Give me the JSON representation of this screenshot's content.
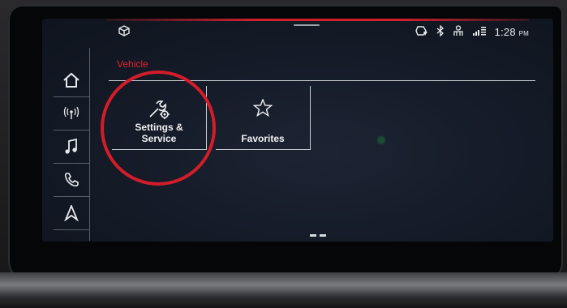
{
  "status_bar": {
    "time": "1:28",
    "ampm": "PM",
    "icons": [
      "car-model-icon",
      "wireless-charging-icon",
      "bluetooth-icon",
      "user-profile-icon",
      "lte-signal-icon"
    ]
  },
  "sidebar": {
    "items": [
      {
        "name": "home",
        "icon": "home-icon"
      },
      {
        "name": "radio",
        "icon": "radio-antenna-icon"
      },
      {
        "name": "media",
        "icon": "music-note-icon"
      },
      {
        "name": "phone",
        "icon": "phone-icon"
      },
      {
        "name": "navigation",
        "icon": "navigation-arrow-icon"
      }
    ]
  },
  "breadcrumb": "Vehicle",
  "tiles": [
    {
      "label_line1": "Settings &",
      "label_line2": "Service",
      "icon": "wrench-gear-icon"
    },
    {
      "label": "Favorites",
      "icon": "star-icon"
    }
  ],
  "colors": {
    "accent_red": "#d2202b",
    "screen_bg": "#141a26",
    "text": "#f1f2f4"
  }
}
